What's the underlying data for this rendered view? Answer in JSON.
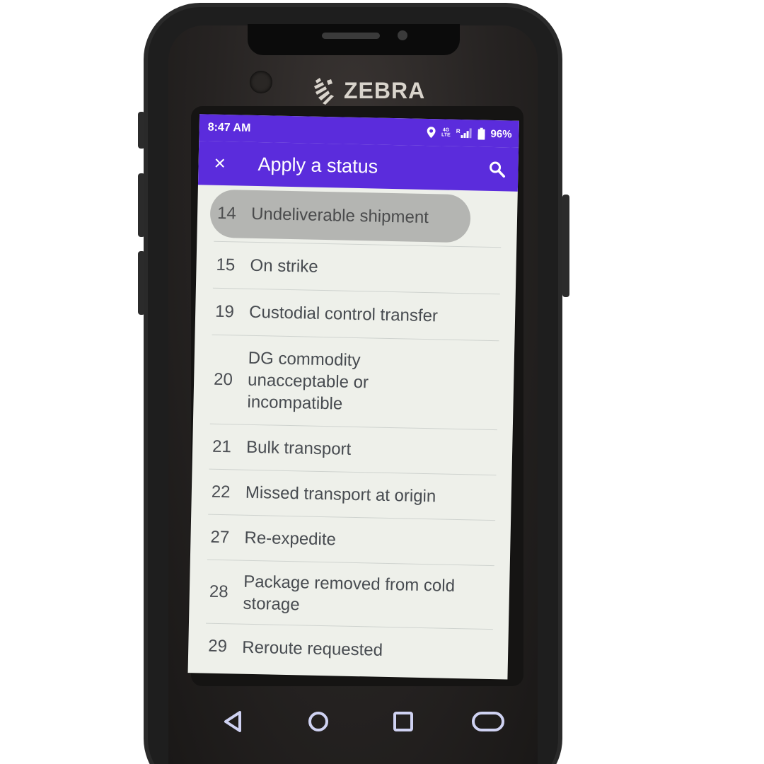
{
  "device": {
    "brand": "ZEBRA"
  },
  "statusbar": {
    "time": "8:47 AM",
    "network": "4G",
    "network_sub": "LTE",
    "roaming": "R",
    "battery": "96%"
  },
  "appbar": {
    "title": "Apply a status",
    "close_icon": "×"
  },
  "colors": {
    "accent": "#5b2cdc",
    "list_background": "#eef0ea",
    "selection": "#a9aaa8"
  },
  "statuses": [
    {
      "code": "14",
      "label": "Undeliverable shipment",
      "selected": true
    },
    {
      "code": "15",
      "label": "On strike"
    },
    {
      "code": "19",
      "label": "Custodial control transfer"
    },
    {
      "code": "20",
      "label": "DG commodity unacceptable or incompatible"
    },
    {
      "code": "21",
      "label": "Bulk transport"
    },
    {
      "code": "22",
      "label": "Missed transport at origin"
    },
    {
      "code": "27",
      "label": "Re-expedite"
    },
    {
      "code": "28",
      "label": "Package removed from cold storage"
    },
    {
      "code": "29",
      "label": "Reroute requested"
    }
  ],
  "navbar": {
    "icons": [
      "back-icon",
      "home-icon",
      "recents-icon",
      "pill-icon"
    ]
  }
}
